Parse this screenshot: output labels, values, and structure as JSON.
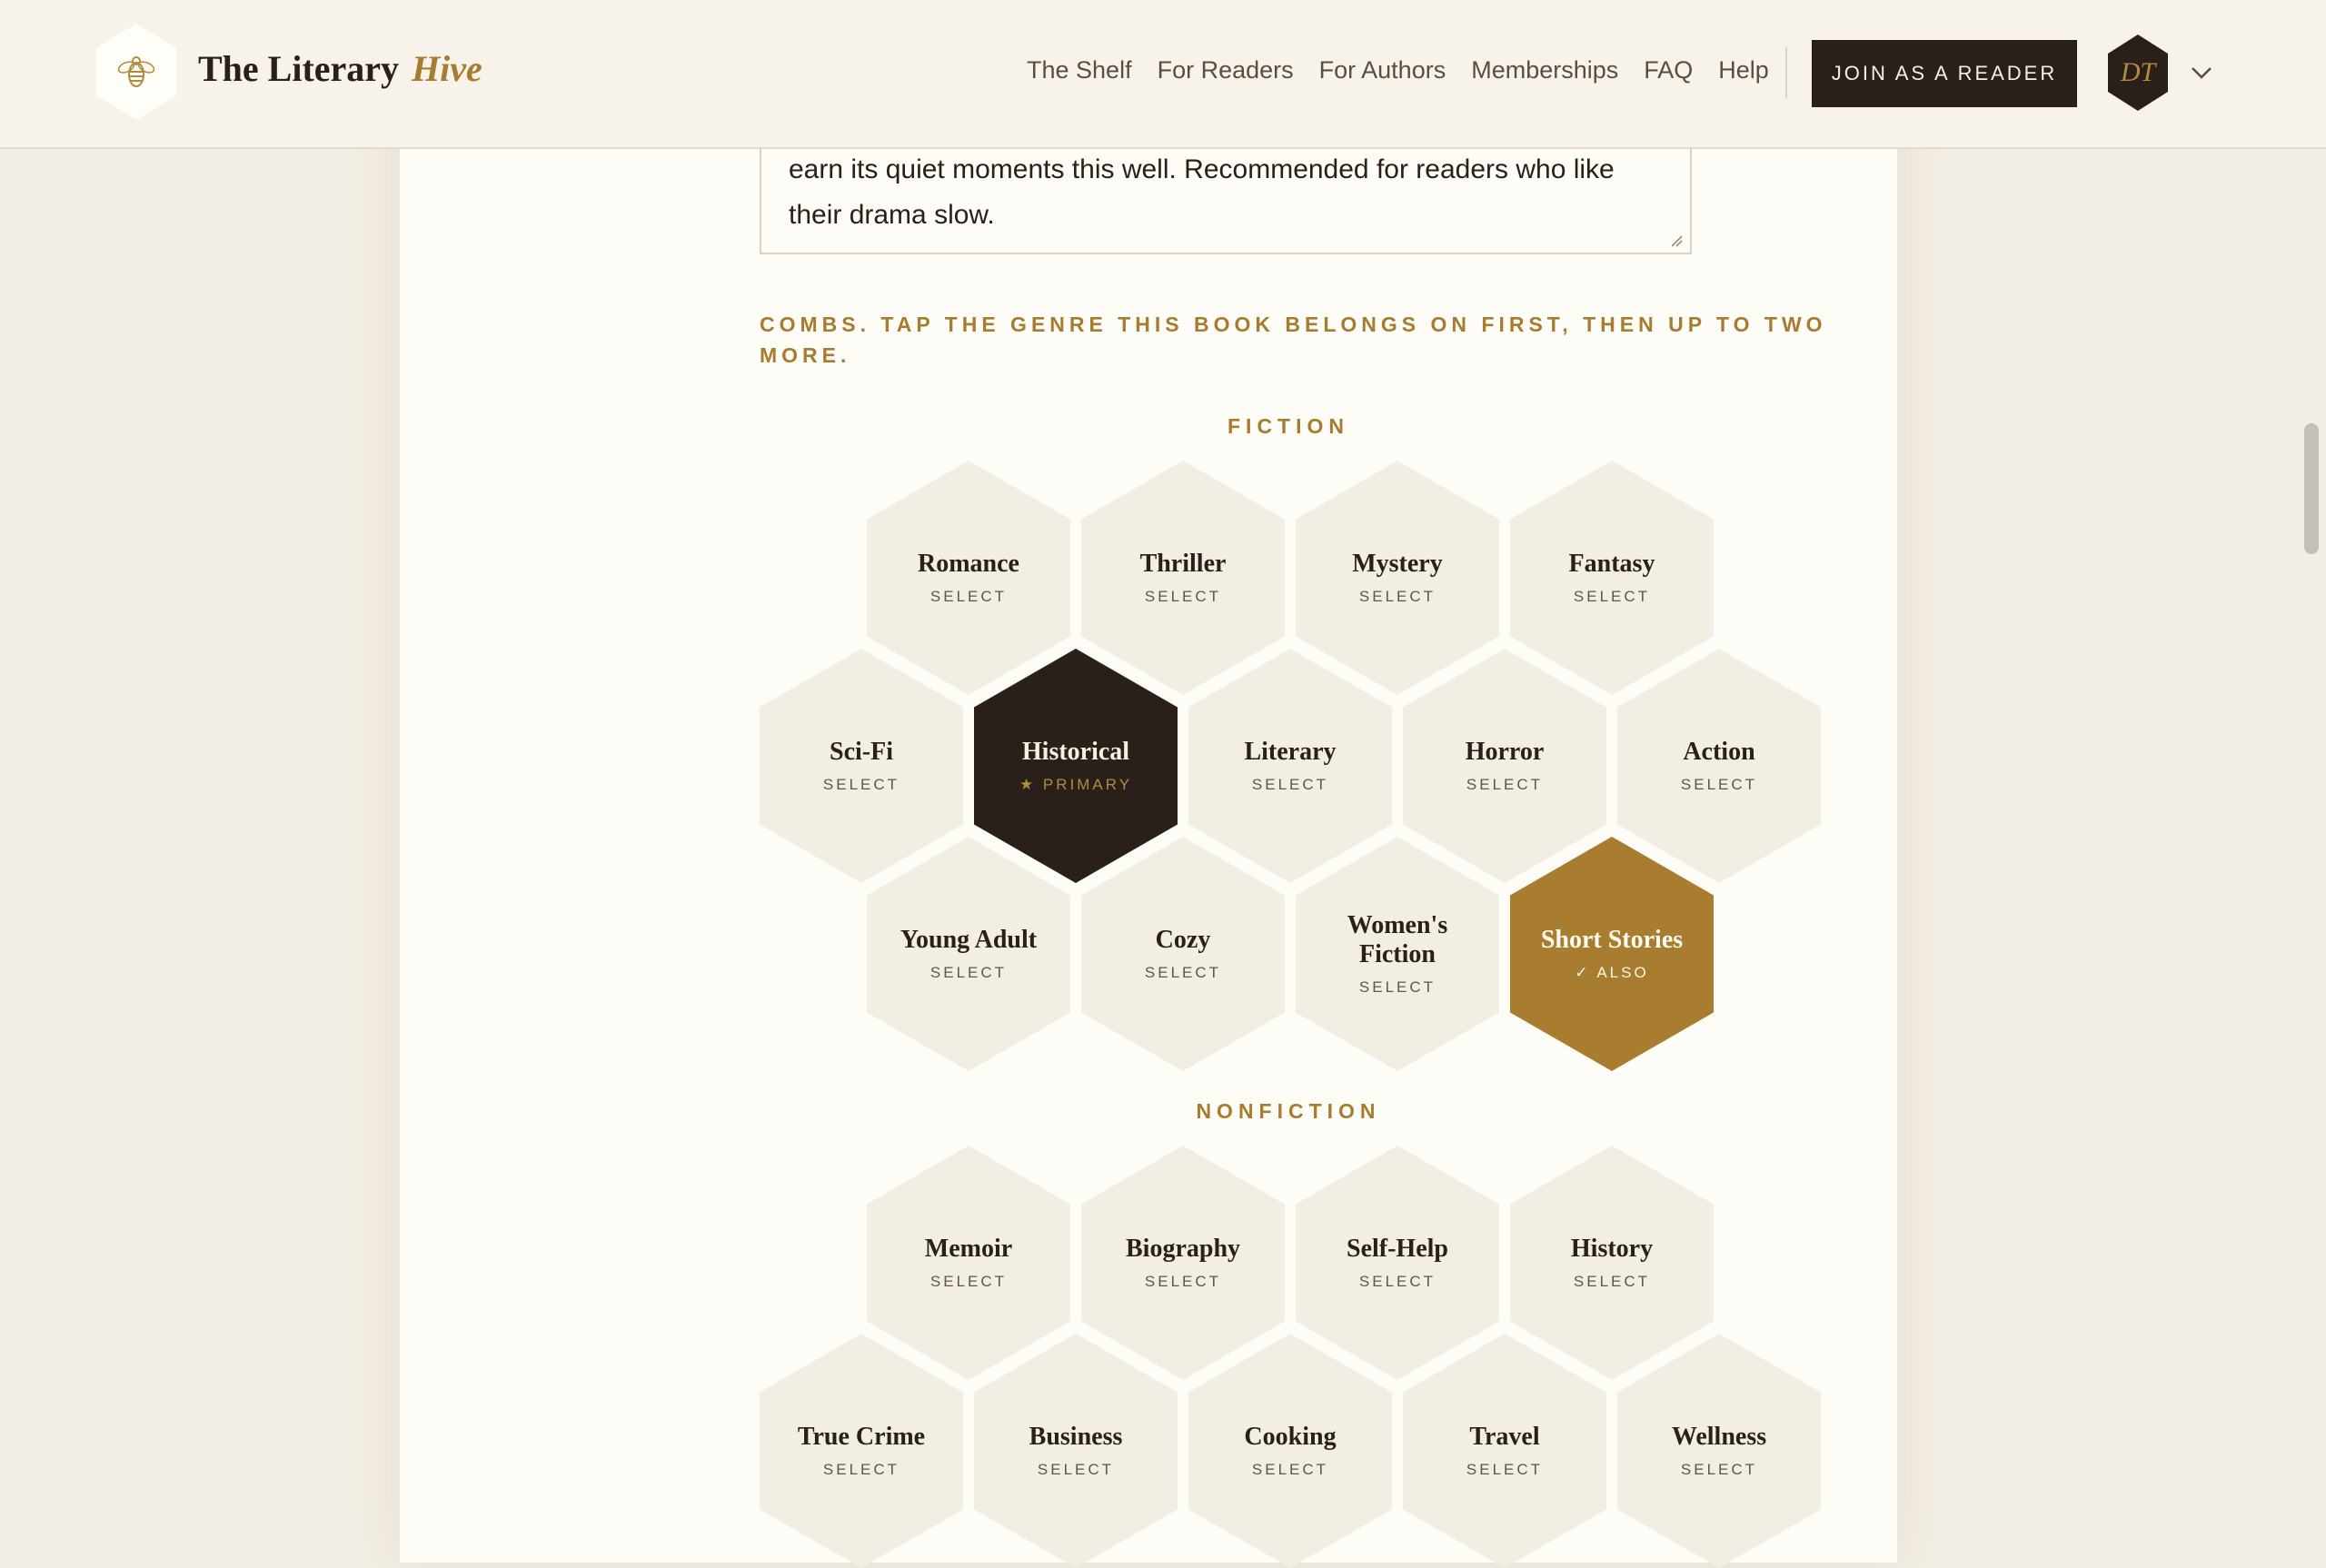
{
  "header": {
    "logo_word1": "The Literary",
    "logo_word2": "Hive",
    "nav": [
      "The Shelf",
      "For Readers",
      "For Authors",
      "Memberships",
      "FAQ",
      "Help"
    ],
    "join_label": "JOIN AS A READER",
    "avatar_initials": "DT"
  },
  "review": {
    "text": "earn its quiet moments this well. Recommended for readers who like their drama slow."
  },
  "instruction": "COMBS. TAP THE GENRE THIS BOOK BELONGS ON FIRST, THEN UP TO TWO MORE.",
  "fiction": {
    "label": "FICTION",
    "genres": [
      {
        "name": "Romance",
        "state": "SELECT"
      },
      {
        "name": "Thriller",
        "state": "SELECT"
      },
      {
        "name": "Mystery",
        "state": "SELECT"
      },
      {
        "name": "Fantasy",
        "state": "SELECT"
      },
      {
        "name": "Sci-Fi",
        "state": "SELECT"
      },
      {
        "name": "Historical",
        "state": "★ PRIMARY"
      },
      {
        "name": "Literary",
        "state": "SELECT"
      },
      {
        "name": "Horror",
        "state": "SELECT"
      },
      {
        "name": "Action",
        "state": "SELECT"
      },
      {
        "name": "Young Adult",
        "state": "SELECT"
      },
      {
        "name": "Cozy",
        "state": "SELECT"
      },
      {
        "name": "Women's Fiction",
        "state": "SELECT"
      },
      {
        "name": "Short Stories",
        "state": "✓ ALSO"
      }
    ]
  },
  "nonfiction": {
    "label": "NONFICTION",
    "genres": [
      {
        "name": "Memoir",
        "state": "SELECT"
      },
      {
        "name": "Biography",
        "state": "SELECT"
      },
      {
        "name": "Self-Help",
        "state": "SELECT"
      },
      {
        "name": "History",
        "state": "SELECT"
      },
      {
        "name": "True Crime",
        "state": "SELECT"
      },
      {
        "name": "Business",
        "state": "SELECT"
      },
      {
        "name": "Cooking",
        "state": "SELECT"
      },
      {
        "name": "Travel",
        "state": "SELECT"
      },
      {
        "name": "Wellness",
        "state": "SELECT"
      }
    ]
  },
  "colors": {
    "accent_gold": "#a77c2f",
    "dark": "#2a201a",
    "hex_default": "#f3eee3",
    "card": "#fefcf7",
    "background": "#f3eee5"
  }
}
